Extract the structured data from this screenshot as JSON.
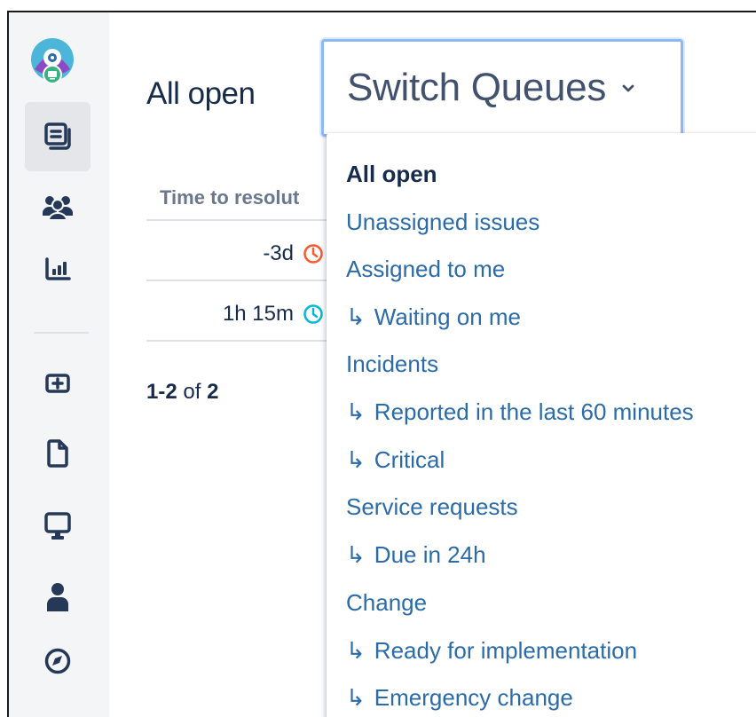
{
  "page": {
    "title": "All open"
  },
  "queue_switcher": {
    "label": "Switch Queues"
  },
  "table": {
    "column_header": "Time to resolut",
    "rows": [
      {
        "time": "-3d",
        "status": "overdue",
        "clock_color": "#ff5630"
      },
      {
        "time": "1h 15m",
        "status": "ok",
        "clock_color": "#00b8d9"
      }
    ]
  },
  "pagination": {
    "range_start": "1",
    "range_sep": "-",
    "range_end": "2",
    "of_label": " of ",
    "total": "2"
  },
  "dropdown": {
    "sub_prefix": "↳",
    "items": [
      {
        "label": "All open",
        "selected": true,
        "sub": false
      },
      {
        "label": "Unassigned issues",
        "selected": false,
        "sub": false
      },
      {
        "label": "Assigned to me",
        "selected": false,
        "sub": false
      },
      {
        "label": "Waiting on me",
        "selected": false,
        "sub": true
      },
      {
        "label": "Incidents",
        "selected": false,
        "sub": false
      },
      {
        "label": "Reported in the last 60 minutes",
        "selected": false,
        "sub": true
      },
      {
        "label": "Critical",
        "selected": false,
        "sub": true
      },
      {
        "label": "Service requests",
        "selected": false,
        "sub": false
      },
      {
        "label": "Due in 24h",
        "selected": false,
        "sub": true
      },
      {
        "label": "Change",
        "selected": false,
        "sub": false
      },
      {
        "label": "Ready for implementation",
        "selected": false,
        "sub": true
      },
      {
        "label": "Emergency change",
        "selected": false,
        "sub": true
      }
    ]
  },
  "sidebar": {
    "items": [
      {
        "icon": "queues-icon",
        "active": true
      },
      {
        "icon": "customers-icon",
        "active": false
      },
      {
        "icon": "reports-icon",
        "active": false
      },
      {
        "icon": "add-item-icon",
        "active": false
      },
      {
        "icon": "knowledge-base-icon",
        "active": false
      },
      {
        "icon": "channels-icon",
        "active": false
      },
      {
        "icon": "people-icon",
        "active": false
      },
      {
        "icon": "getting-started-icon",
        "active": false
      }
    ]
  },
  "colors": {
    "link": "#2a6ba8",
    "text": "#172b4d",
    "sidebar_bg": "#f4f5f7",
    "focus_ring": "#8fb8f0"
  }
}
